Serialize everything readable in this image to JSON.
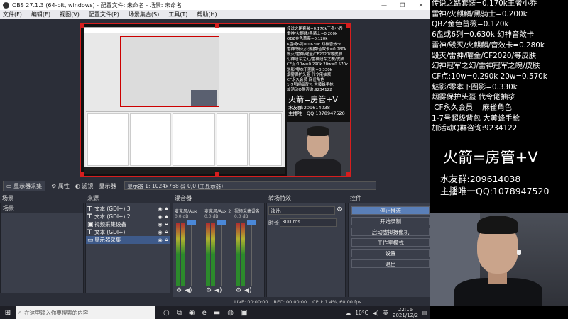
{
  "window": {
    "title": "OBS 27.1.3 (64-bit, windows) - 配置文件: 未命名 - 场景: 未命名",
    "controls": [
      "—",
      "❐",
      "✕"
    ]
  },
  "menu": [
    "文件(F)",
    "编辑(E)",
    "视图(V)",
    "配置文件(P)",
    "场景集合(S)",
    "工具(T)",
    "帮助(H)"
  ],
  "preview_overlay": {
    "info": "传说之路套装=0.170k王者小乔\n雷神/火麒麟/黑骑士=0.200k\nQBZ金色蔷薇=0.120k\n6盘或6列=0.630k 幻神音效卡\n雷神/毁灭/火麒麟/音效卡=0.280k\n毁灭/雷神/曜金/CF2020/等皮肤\n幻神冠军之幻/雷神冠军之魄/皮肤\nCF点:10w=0.290k 20w=0.570k\n魅影/零本下圈影=0.330k\n烟雾保护头盔 代令佬抽浆\nCF永久会员 麻雀角色\n1-7号超级背包 大黄蜂手枪\n加活动Q群咨询:9234122",
    "big": "火箭=房管+V",
    "qq": "水友群:209614038\n主播唯一QQ:1078947520"
  },
  "scene_toolbar": {
    "source_label": "显示器采集",
    "properties": "属性",
    "filters": "滤镜",
    "display_label": "显示器",
    "display_value": "显示器 1: 1024x768 @ 0,0 (主显示器)"
  },
  "docks": {
    "scenes_title": "场景",
    "sources_title": "来源",
    "mixer_title": "混音器",
    "transitions_title": "转场特效",
    "controls_title": "控件"
  },
  "scenes": [
    "场景"
  ],
  "sources": [
    {
      "icon": "T",
      "label": "文本 (GDI+) 3",
      "selected": false
    },
    {
      "icon": "T",
      "label": "文本 (GDI+) 2",
      "selected": false
    },
    {
      "icon": "▣",
      "label": "视频采集设备",
      "selected": false
    },
    {
      "icon": "T",
      "label": "文本 (GDI+)",
      "selected": false
    },
    {
      "icon": "▭",
      "label": "显示器采集",
      "selected": true
    }
  ],
  "mixer": [
    {
      "label": "麦克风/Aux",
      "db": "0.0 dB"
    },
    {
      "label": "麦克风/Aux 2",
      "db": "0.0 dB"
    },
    {
      "label": "视频采集设备",
      "db": "0.0 dB"
    }
  ],
  "transitions": {
    "selected": "淡出",
    "duration_label": "时长",
    "duration_value": "300 ms"
  },
  "controls": [
    "停止推流",
    "开始录制",
    "启动虚拟摄像机",
    "工作室模式",
    "设置",
    "退出"
  ],
  "dock_footer": {
    "scenes": "+ − ∧ ∨",
    "sources": "+ − ⚙ ∧ ∨"
  },
  "status": {
    "live": "LIVE: 00:00:00",
    "rec": "REC: 00:00:00",
    "cpu": "CPU: 1.4%, 60.00 fps"
  },
  "overlay": {
    "info": "传说之路套装=0.170k王者小乔\n雷神/火麒麟/黑骑士=0.200k\nQBZ金色蔷薇=0.120k\n6盘或6列=0.630k 幻神音效卡\n雷神/毁灭/火麒麟/音效卡=0.280k\n毁灭/雷神/曜金/CF2020/等皮肤\n幻神冠军之幻/雷神冠军之魄/皮肤\nCF点:10w=0.290k 20w=0.570k\n魅影/零本下圈影=0.330k\n烟雾保护头盔 代令佬抽浆\n CF永久会员    麻雀角色\n1-7号超级背包 大黄蜂手枪\n加活动Q群咨询:9234122",
    "big": "火箭=房管+V",
    "qq": "水友群:209614038\n主播唯一QQ:1078947520"
  },
  "taskbar": {
    "search_placeholder": "在这里输入你要搜索的内容",
    "temperature": "10°C",
    "ime": "英",
    "time": "22:16",
    "date": "2021/12/2"
  }
}
